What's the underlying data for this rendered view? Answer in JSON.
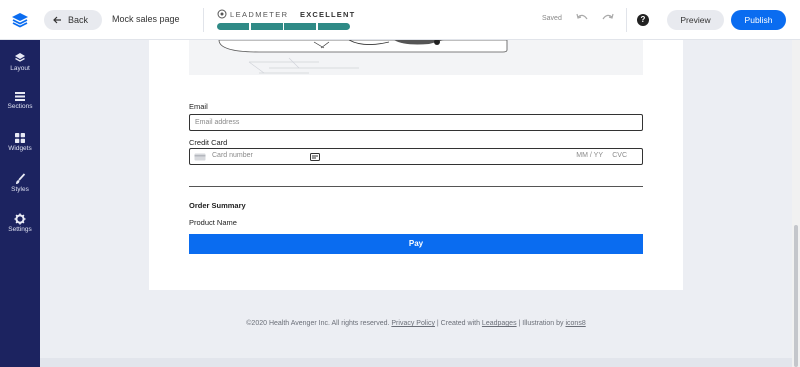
{
  "topbar": {
    "back_label": "Back",
    "page_name": "Mock sales page",
    "leadmeter_label": "LEADMETER",
    "leadmeter_score": "EXCELLENT",
    "leadmeter_segments": 4,
    "status": "Saved",
    "help_label": "?",
    "preview_label": "Preview",
    "publish_label": "Publish",
    "accent_color": "#0a6cf0",
    "meter_color": "#2f8a86"
  },
  "sidebar": {
    "items": [
      {
        "label": "Layout",
        "icon": "layers-icon"
      },
      {
        "label": "Sections",
        "icon": "sections-icon"
      },
      {
        "label": "Widgets",
        "icon": "widgets-icon"
      },
      {
        "label": "Styles",
        "icon": "brush-icon"
      },
      {
        "label": "Settings",
        "icon": "gear-icon"
      }
    ],
    "background": "#1c2360"
  },
  "form": {
    "email_label": "Email",
    "email_placeholder": "Email address",
    "cc_label": "Credit Card",
    "cc_placeholder": "Card number",
    "cc_expiry": "MM / YY",
    "cc_cvc": "CVC",
    "summary_title": "Order Summary",
    "product_name": "Product Name",
    "pay_label": "Pay"
  },
  "footer": {
    "copyright": "©2020 Health Avenger Inc.  All rights reserved.",
    "privacy": "Privacy Policy",
    "sep1": " | Created with ",
    "leadpages": "Leadpages",
    "sep2": " | Illustration by ",
    "icons8": "icons8"
  }
}
